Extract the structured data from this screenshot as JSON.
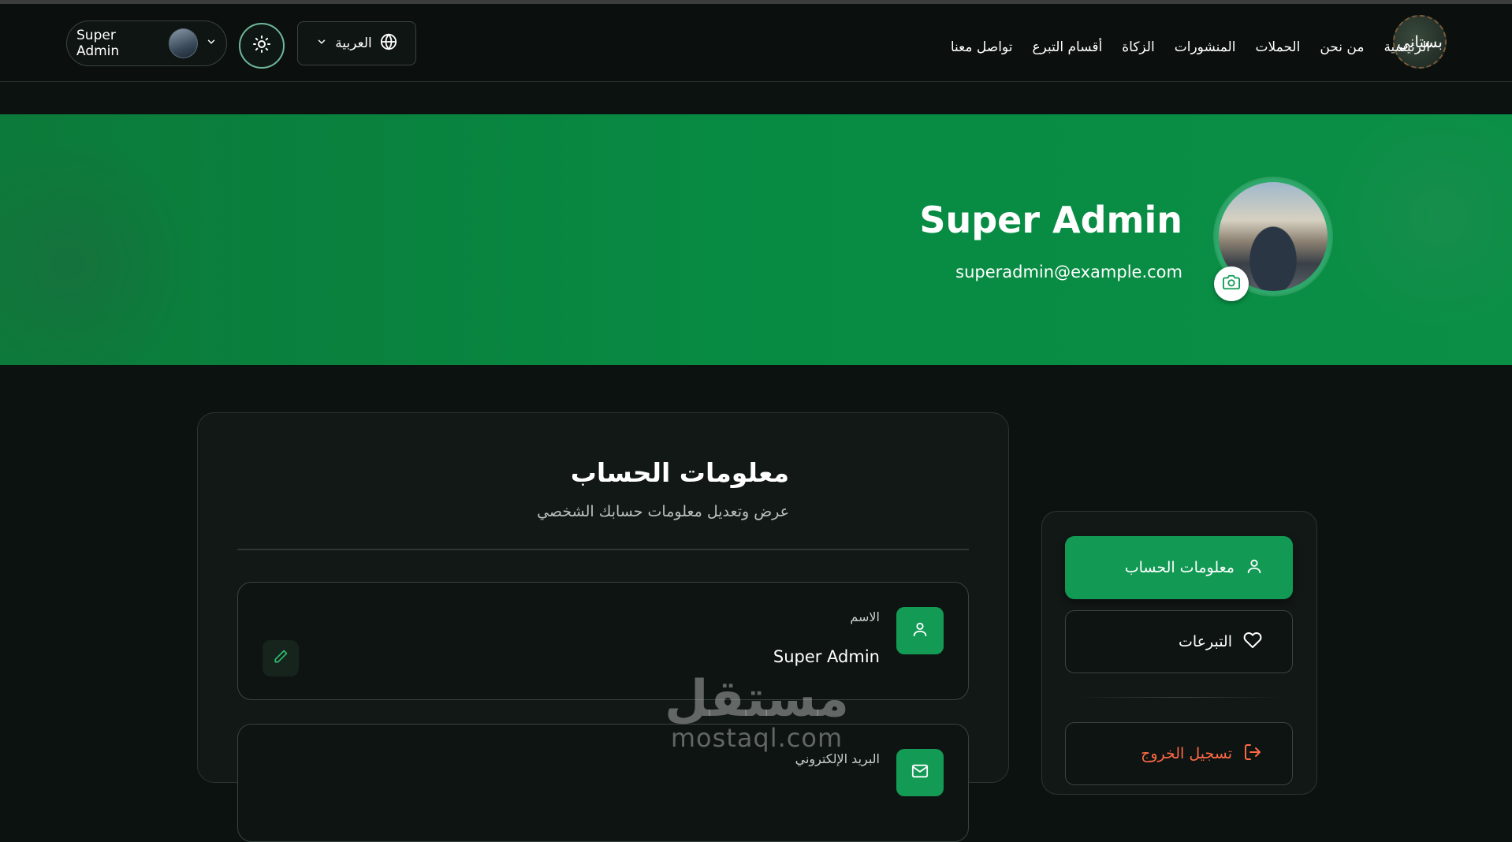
{
  "navbar": {
    "logo_text": "بستاني",
    "links": [
      "الرئيسية",
      "من نحن",
      "الحملات",
      "المنشورات",
      "الزكاة",
      "أقسام التبرع",
      "تواصل معنا"
    ],
    "language_label": "العربية",
    "user_name": "Super Admin"
  },
  "hero": {
    "name": "Super Admin",
    "email": "superadmin@example.com"
  },
  "account": {
    "title": "معلومات الحساب",
    "subtitle": "عرض وتعديل معلومات حسابك الشخصي",
    "fields": [
      {
        "label": "الاسم",
        "value": "Super Admin"
      },
      {
        "label": "البريد الإلكتروني",
        "value": ""
      }
    ]
  },
  "sidebar": {
    "items": [
      {
        "label": "معلومات الحساب",
        "icon": "user-icon",
        "active": true
      },
      {
        "label": "التبرعات",
        "icon": "heart-icon",
        "active": false
      }
    ],
    "logout_label": "تسجيل الخروج"
  },
  "watermark": {
    "arabic": "مستقل",
    "latin": "mostaql.com"
  },
  "colors": {
    "accent": "#129a55",
    "hero_bg": "#078b43",
    "logout": "#ff6a45",
    "background": "#0c1210"
  }
}
